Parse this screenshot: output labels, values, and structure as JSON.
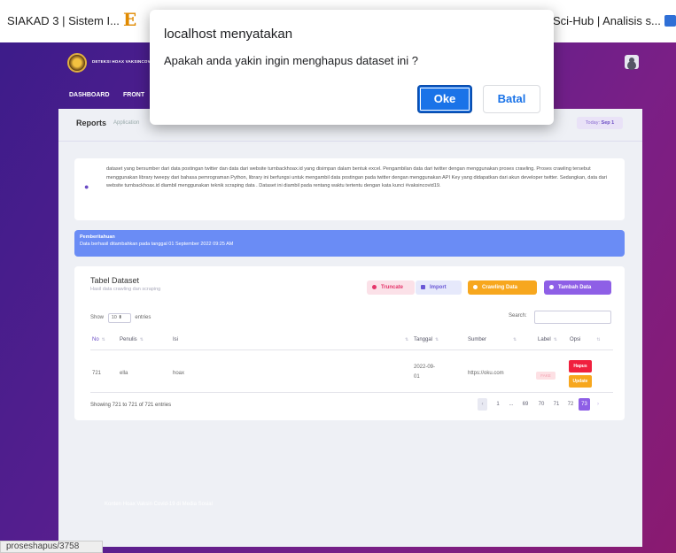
{
  "browser": {
    "tab_left": "SIAKAD 3 | Sistem I...",
    "tab_brand_glyph": "E",
    "tab_right": "Sci-Hub | Analisis s..."
  },
  "app": {
    "title": "DETEKSI HOAX VAKSINCOVID",
    "menu": [
      "DASHBOARD",
      "FRONT"
    ]
  },
  "reports": {
    "title": "Reports",
    "subtitle": "Application",
    "today_label": "Today:",
    "today_value": "Sep 1"
  },
  "info": {
    "text": "dataset yang bersumber dari data postingan twitter dan data dari website turnbackhoax.id yang disimpan dalam bentuk excel. Pengambilan data dari twitter dengan menggunakan proses crawling. Proses crawling tersebut menggunakan library tweepy dari bahasa pemrograman Python, library ini berfungsi untuk mengambil data postingan pada twitter dengan menggunakan API Key yang didapatkan dari akun developer twitter. Sedangkan, data dari website turnbackhoax.id diambil menggunakan teknik scraping data . Dataset ini diambil pada rentang waktu tertentu dengan kata kunci #vaksincovid19."
  },
  "notice": {
    "title": "Pemberitahuan",
    "body": "Data berhasil ditambahkan pada tanggal 01 September 2022 09:25 AM"
  },
  "table": {
    "title": "Tabel Dataset",
    "subtitle": "Hasil data crawling dan scraping",
    "buttons": {
      "truncate": "Truncate",
      "import": "Import",
      "crawling": "Crawling Data",
      "add": "Tambah Data"
    },
    "show_label": "Show",
    "show_value": "10",
    "entries_label": "entries",
    "search_label": "Search:",
    "columns": [
      "No",
      "Penulis",
      "Isi",
      "Tanggal",
      "Sumber",
      "Label",
      "Opsi"
    ],
    "row": {
      "no": "721",
      "penulis": "ella",
      "isi": "hoax",
      "tanggal_1": "2022-09-",
      "tanggal_2": "01",
      "sumber": "https://oku.com",
      "label": "FAKE",
      "hapus": "Hapus",
      "update": "Update"
    },
    "showing": "Showing 721 to 721 of 721 entries",
    "pager": [
      "‹",
      "1",
      "...",
      "69",
      "70",
      "71",
      "72",
      "73",
      "›"
    ]
  },
  "footer": {
    "text": "Konten Hoax Vaksin Covid-19 di Media Sosial",
    "status_url": "proseshapus/3758"
  },
  "dialog": {
    "title": "localhost menyatakan",
    "message": "Apakah anda yakin ingin menghapus dataset ini ?",
    "ok": "Oke",
    "cancel": "Batal"
  }
}
